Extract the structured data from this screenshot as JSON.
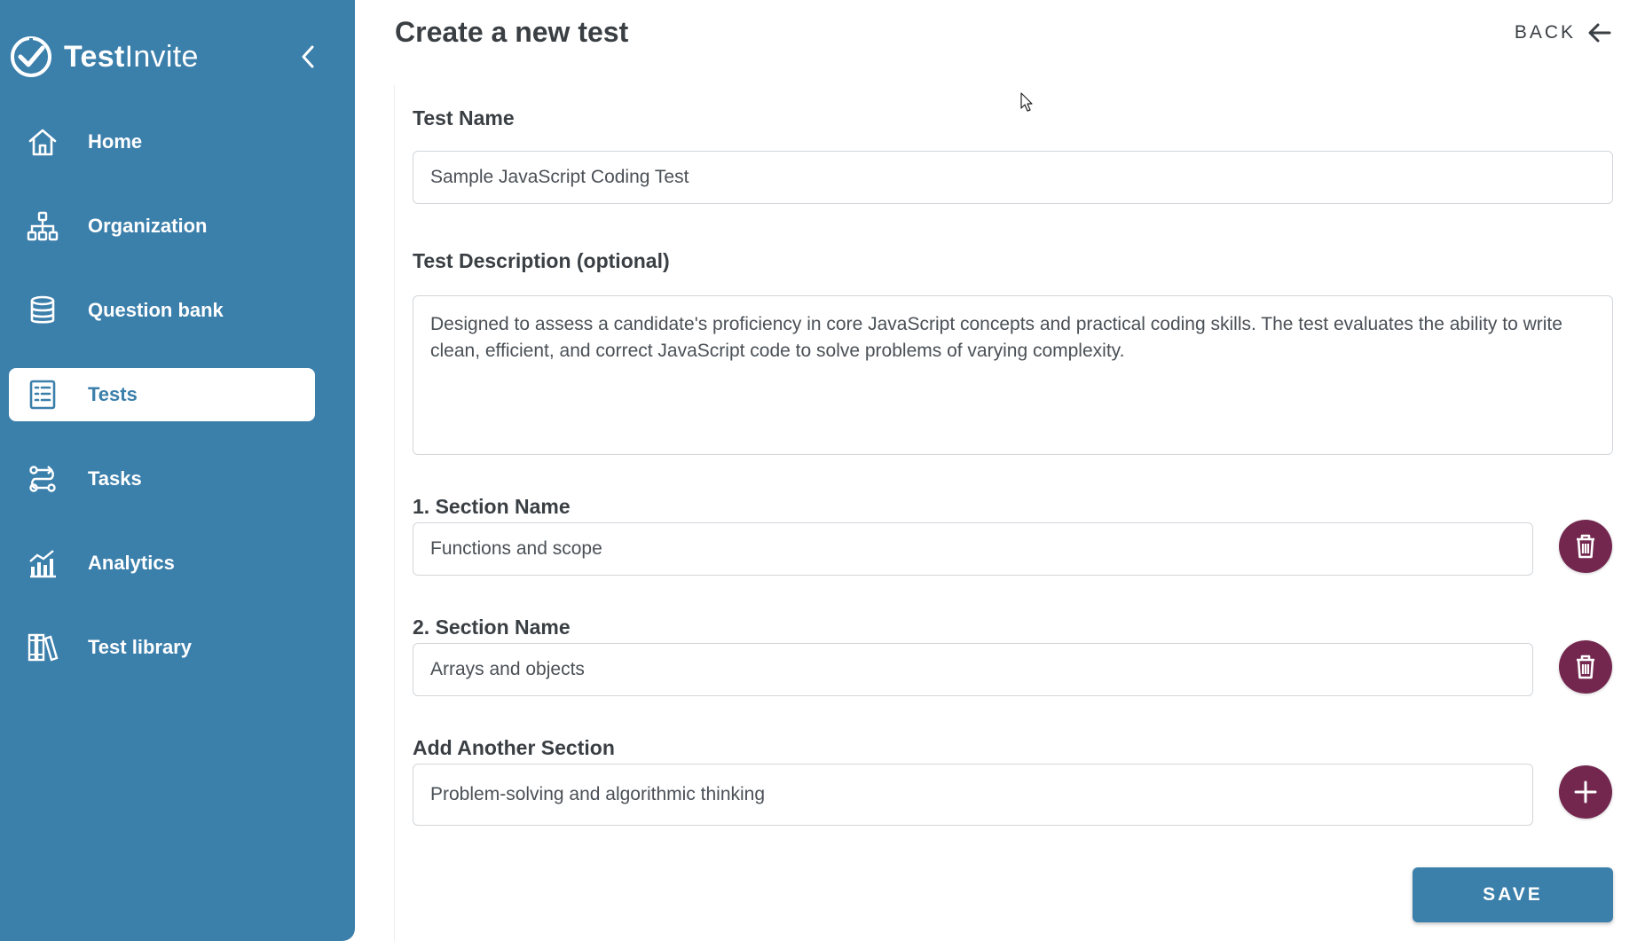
{
  "app": {
    "brand_bold": "Test",
    "brand_light": "Invite"
  },
  "sidebar": {
    "items": [
      {
        "label": "Home",
        "icon": "home-icon",
        "active": false
      },
      {
        "label": "Organization",
        "icon": "org-chart-icon",
        "active": false
      },
      {
        "label": "Question bank",
        "icon": "database-icon",
        "active": false
      },
      {
        "label": "Tests",
        "icon": "checklist-icon",
        "active": true
      },
      {
        "label": "Tasks",
        "icon": "route-icon",
        "active": false
      },
      {
        "label": "Analytics",
        "icon": "analytics-icon",
        "active": false
      },
      {
        "label": "Test library",
        "icon": "library-icon",
        "active": false
      }
    ]
  },
  "header": {
    "title": "Create a new test",
    "back_label": "BACK"
  },
  "form": {
    "test_name_label": "Test Name",
    "test_name_value": "Sample JavaScript Coding Test",
    "description_label": "Test Description (optional)",
    "description_value": "Designed to assess a candidate's proficiency in core JavaScript concepts and practical coding skills. The test evaluates the ability to write clean, efficient, and correct JavaScript code to solve problems of varying complexity.",
    "sections": [
      {
        "label": "1. Section Name",
        "value": "Functions and scope"
      },
      {
        "label": "2. Section Name",
        "value": "Arrays and objects"
      }
    ],
    "add_section_label": "Add Another Section",
    "add_section_value": "Problem-solving and algorithmic thinking",
    "save_label": "SAVE"
  },
  "colors": {
    "sidebar": "#3b7fab",
    "action_round": "#73274f",
    "text": "#3a3f44"
  }
}
